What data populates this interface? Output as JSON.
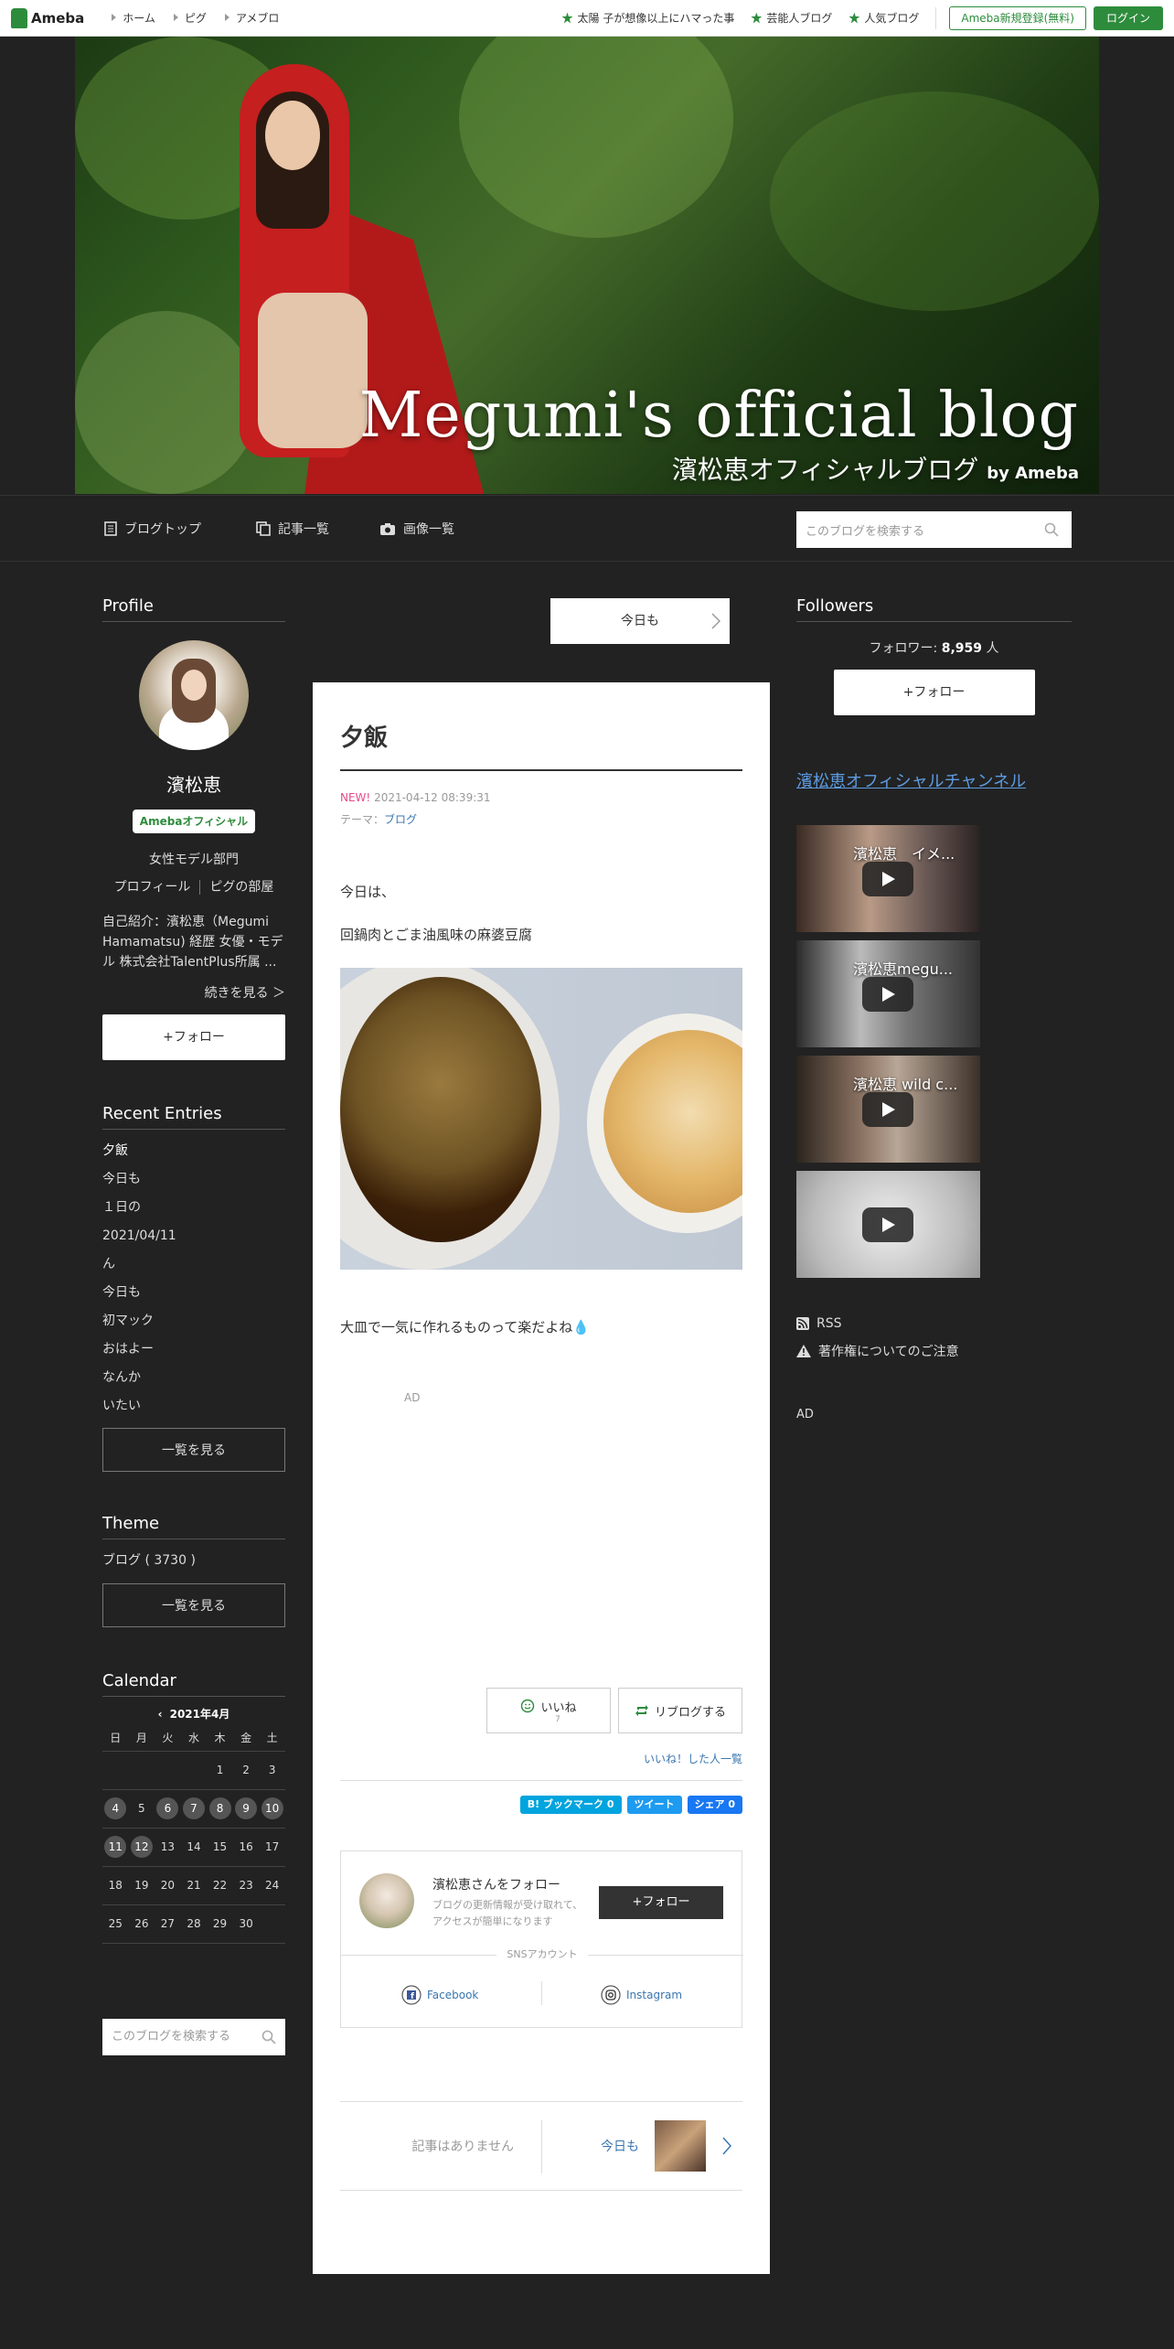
{
  "topbar": {
    "logo": "Ameba",
    "nav": [
      "ホーム",
      "ピグ",
      "アメブロ"
    ],
    "picks": [
      "太陽 子が想像以上にハマった事",
      "芸能人ブログ",
      "人気ブログ"
    ],
    "register": "Ameba新規登録(無料)",
    "login": "ログイン"
  },
  "header": {
    "title": "Megumi's official blog",
    "subtitle": "濱松恵オフィシャルブログ",
    "by": "by Ameba"
  },
  "blognav": {
    "top": "ブログトップ",
    "entries": "記事一覧",
    "images": "画像一覧",
    "search_placeholder": "このブログを検索する"
  },
  "profile": {
    "heading": "Profile",
    "name": "濱松恵",
    "badge": "Amebaオフィシャル",
    "category": "女性モデル部門",
    "link_profile": "プロフィール",
    "link_pig": "ピグの部屋",
    "intro": "自己紹介：濱松恵（Megumi Hamamatsu) 経歴 女優・モデル 株式会社TalentPlus所属 ...",
    "more": "続きを見る ＞",
    "follow": "+フォロー"
  },
  "recent": {
    "heading": "Recent Entries",
    "items": [
      "夕飯",
      "今日も",
      "１日の",
      "2021/04/11",
      "ん",
      "今日も",
      "初マック",
      "おはよー",
      "なんか",
      "いたい"
    ],
    "all": "一覧を見る"
  },
  "theme": {
    "heading": "Theme",
    "item": "ブログ ( 3730 )",
    "all": "一覧を見る"
  },
  "calendar": {
    "heading": "Calendar",
    "month": "2021年4月",
    "weekdays": [
      "日",
      "月",
      "火",
      "水",
      "木",
      "金",
      "土"
    ],
    "weeks": [
      [
        "",
        "",
        "",
        "",
        "1",
        "2",
        "3"
      ],
      [
        "4",
        "5",
        "6",
        "7",
        "8",
        "9",
        "10"
      ],
      [
        "11",
        "12",
        "13",
        "14",
        "15",
        "16",
        "17"
      ],
      [
        "18",
        "19",
        "20",
        "21",
        "22",
        "23",
        "24"
      ],
      [
        "25",
        "26",
        "27",
        "28",
        "29",
        "30",
        ""
      ]
    ],
    "posted": [
      "4",
      "6",
      "7",
      "8",
      "9",
      "10",
      "11",
      "12"
    ],
    "search_placeholder": "このブログを検索する"
  },
  "article": {
    "top_button": "今日も",
    "title": "夕飯",
    "new": "NEW!",
    "date": "2021-04-12 08:39:31",
    "theme_label": "テーマ：",
    "theme": "ブログ",
    "p1": "今日は、",
    "p2": "回鍋肉とごま油風味の麻婆豆腐",
    "p3": "大皿で一気に作れるものって楽だよね💧",
    "ad": "AD",
    "like": "いいね",
    "like_count": "7",
    "reblog": "リブログする",
    "like_list": "いいね！した人一覧",
    "share_hatena": "B! ブックマーク  0",
    "share_tweet": "ツイート",
    "share_fb": "シェア 0",
    "follow_title": "濱松恵さんをフォロー",
    "follow_desc": "ブログの更新情報が受け取れて、アクセスが簡単になります",
    "follow_btn": "+フォロー",
    "sns_label": "SNSアカウント",
    "facebook": "Facebook",
    "instagram": "Instagram",
    "prev_none": "記事はありません",
    "next": "今日も"
  },
  "followers": {
    "heading": "Followers",
    "count_label": "フォロワー:",
    "count": "8,959",
    "unit": "人",
    "follow": "+フォロー",
    "channel": "濱松恵オフィシャルチャンネル",
    "videos": [
      "濱松恵　イメ...",
      "濱松恵megu...",
      "濱松恵 wild c...",
      ""
    ],
    "rss": "RSS",
    "copyright": "著作権についてのご注意",
    "ad": "AD"
  },
  "colors": {
    "brand": "#2d8c3c",
    "bg": "#222222",
    "link": "#3a76b0"
  }
}
